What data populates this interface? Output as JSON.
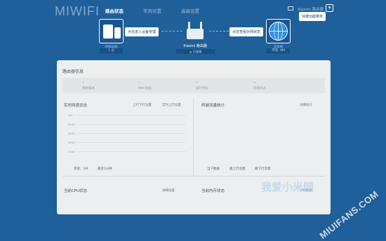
{
  "header": {
    "logo": "MIWIFI",
    "tabs": [
      {
        "label": "路由状态",
        "active": true
      },
      {
        "label": "常用设置",
        "active": false
      },
      {
        "label": "高级设置",
        "active": false
      }
    ],
    "user_name": "Xiaomi 路由器",
    "menu_glyph": "▾",
    "quick_setup_tooltip": "快捷功能菜单"
  },
  "topology": {
    "devices": {
      "caption": "终端设备",
      "count": "1 台"
    },
    "devices_tooltip": "点击进入设备管理",
    "router": {
      "model": "Xiaomi 路由器",
      "status": "已连接"
    },
    "internet_tooltip": "点击查看外网状态",
    "internet": {
      "caption": "互联网",
      "bandwidth": "带宽: 8M"
    }
  },
  "panel": {
    "title": "路由器信息",
    "info": [
      {
        "value": "--",
        "label": "系统版本"
      },
      {
        "value": "--",
        "label": "MAC地址"
      },
      {
        "value": "--",
        "label": "运行时长"
      },
      {
        "value": "--",
        "label": "连接状态"
      }
    ],
    "realtime": {
      "title": "实时网速状态",
      "upload_link": "上行下行设置",
      "download_link": "实时上行设置",
      "y_ticks": [
        "1M",
        "800K",
        "600K",
        "400K",
        "200K"
      ],
      "footer_a": "带宽：1M",
      "footer_b": "最近1分钟"
    },
    "traffic": {
      "title": "终端流量统计",
      "detail_link": "详细统计",
      "footer_a": "当下数据",
      "footer_b": "最上行流量",
      "footer_c": "最下行流量"
    },
    "cpu": {
      "title": "当前CPU状态",
      "link": "详细设置"
    },
    "memory": {
      "title": "当前内存状态",
      "link": "详细数据"
    }
  },
  "watermark": {
    "site": "MIUIFANS.COM",
    "cn": "我爱小米网"
  },
  "colors": {
    "background": "#1f5f9a",
    "panel": "#eceeef",
    "accent": "#2f8fe0",
    "online": "#4caf50"
  }
}
